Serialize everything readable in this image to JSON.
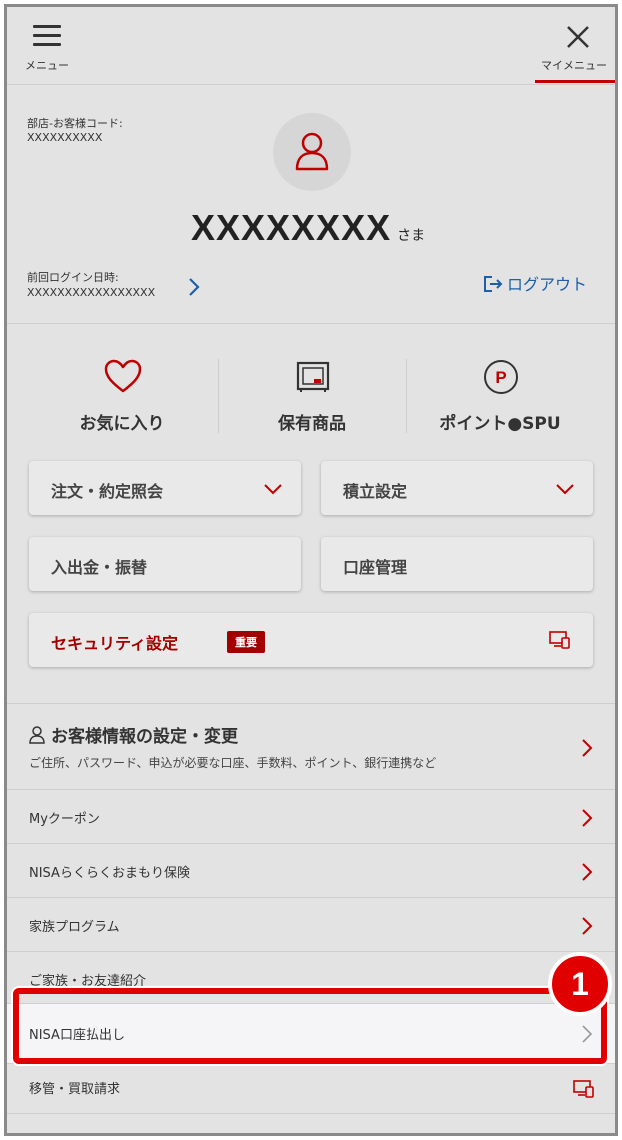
{
  "header": {
    "menu_label": "メニュー",
    "close_label": "マイメニュー"
  },
  "account": {
    "code_label": "部店-お客様コード:",
    "code_value": "XXXXXXXXXX",
    "name": "XXXXXXXX",
    "honorific": "さま",
    "last_login_label": "前回ログイン日時:",
    "last_login_value": "XXXXXXXXXXXXXXXXX",
    "logout_label": "ログアウト"
  },
  "quick_links": [
    {
      "label": "お気に入り",
      "icon": "heart-icon"
    },
    {
      "label": "保有商品",
      "icon": "holdings-icon"
    },
    {
      "label": "ポイント●SPU",
      "icon": "point-icon"
    }
  ],
  "buttons": {
    "orders": "注文・約定照会",
    "accumulation": "積立設定",
    "deposit": "入出金・振替",
    "account_mgmt": "口座管理",
    "security": "セキュリティ設定",
    "security_badge": "重要"
  },
  "profile": {
    "title": "お客様情報の設定・変更",
    "subtitle": "ご住所、パスワード、申込が必要な口座、手数料、ポイント、銀行連携など"
  },
  "list": [
    {
      "label": "Myクーポン"
    },
    {
      "label": "NISAらくらくおまもり保険"
    },
    {
      "label": "家族プログラム"
    },
    {
      "label": "ご家族・お友達紹介"
    },
    {
      "label": "NISA口座払出し"
    },
    {
      "label": "移管・買取請求"
    }
  ],
  "annotation": {
    "step": "1"
  },
  "colors": {
    "brand_red": "#bf0000",
    "link_blue": "#1d5fa8",
    "highlight_red": "#e00000"
  }
}
